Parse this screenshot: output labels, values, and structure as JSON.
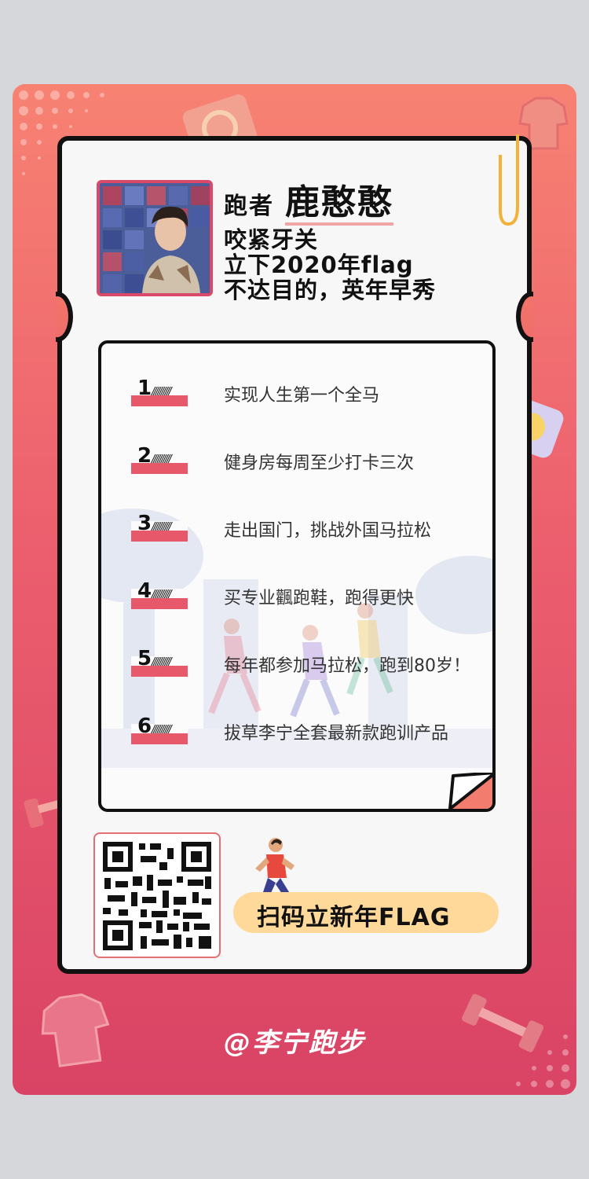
{
  "runner": {
    "label": "跑者",
    "name": "鹿憨憨"
  },
  "headline": [
    "咬紧牙关",
    "立下2020年flag",
    "不达目的，英年早秀"
  ],
  "flags": [
    {
      "num": "1",
      "text": "实现人生第一个全马"
    },
    {
      "num": "2",
      "text": "健身房每周至少打卡三次"
    },
    {
      "num": "3",
      "text": "走出国门，挑战外国马拉松"
    },
    {
      "num": "4",
      "text": "买专业飌跑鞋，跑得更快"
    },
    {
      "num": "5",
      "text": "每年都参加马拉松，跑到80岁！"
    },
    {
      "num": "6",
      "text": "拔草李宁全套最新款跑训产品"
    }
  ],
  "cta": {
    "label": "扫码立新年FLAG"
  },
  "footer": {
    "handle": "@李宁跑步"
  },
  "colors": {
    "accent": "#e6586a",
    "cta": "#ffd99a",
    "poster_top": "#f78272",
    "poster_bottom": "#d94365"
  }
}
